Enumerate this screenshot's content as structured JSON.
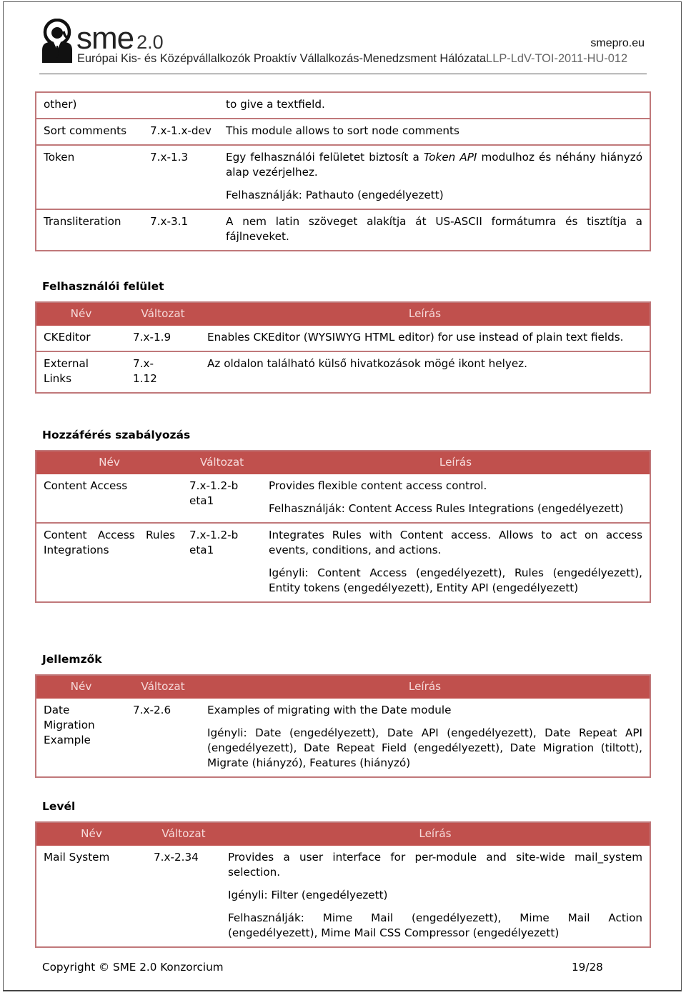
{
  "header": {
    "brand": "sme",
    "brand_version": "2.0",
    "site_url": "smepro.eu",
    "tagline": "Európai Kis- és Középvállalkozók Proaktív Vállalkozás-Menedzsment Hálózata",
    "project_code": "LLP-LdV-TOI-2011-HU-012",
    "logo_icon": "at-sign-person-icon"
  },
  "continued_table": {
    "rows": [
      {
        "name": "other)",
        "version": "",
        "description": [
          "to give a textfield."
        ]
      },
      {
        "name": "Sort comments",
        "version": "7.x-1.x-dev",
        "description": [
          "This module allows to sort node comments"
        ]
      },
      {
        "name": "Token",
        "version": "7.x-1.3",
        "description_pre": "Egy felhasználói felületet biztosít a ",
        "description_em": "Token API",
        "description_post": " modulhoz és néhány hiányzó alap vezérjelhez.",
        "description_extra": "Felhasználják: Pathauto (engedélyezett)"
      },
      {
        "name": "Transliteration",
        "version": "7.x-3.1",
        "description": [
          "A nem latin szöveget alakítja át US-ASCII formátumra és tisztítja a fájlneveket."
        ]
      }
    ]
  },
  "columns": {
    "name": "Név",
    "version": "Változat",
    "description": "Leírás"
  },
  "sections": [
    {
      "title": "Felhasználói felület",
      "rows": [
        {
          "name": "CKEditor",
          "version": "7.x-1.9",
          "description": [
            "Enables CKEditor (WYSIWYG HTML editor) for use instead of plain text fields."
          ]
        },
        {
          "name": "External Links",
          "version": "7.x-1.12",
          "description": [
            "Az oldalon található külső hivatkozások mögé ikont helyez."
          ]
        }
      ]
    },
    {
      "title": "Hozzáférés szabályozás",
      "rows": [
        {
          "name": "Content Access",
          "version": "7.x-1.2-beta1",
          "description": [
            "Provides flexible content access control.",
            "Felhasználják: Content Access Rules Integrations (engedélyezett)"
          ]
        },
        {
          "name": "Content Access Rules Integrations",
          "version": "7.x-1.2-beta1",
          "description": [
            "Integrates Rules with Content access. Allows to act on access events, conditions, and actions.",
            "Igényli: Content Access (engedélyezett), Rules (engedélyezett), Entity tokens (engedélyezett), Entity API (engedélyezett)"
          ]
        }
      ]
    },
    {
      "title": "Jellemzők",
      "rows": [
        {
          "name": "Date Migration Example",
          "version": "7.x-2.6",
          "description": [
            "Examples of migrating with the Date module",
            "Igényli: Date (engedélyezett), Date API (engedélyezett), Date Repeat API (engedélyezett), Date Repeat Field (engedélyezett), Date Migration (tiltott), Migrate (hiányzó), Features (hiányzó)"
          ]
        }
      ]
    },
    {
      "title": "Levél",
      "rows": [
        {
          "name": "Mail System",
          "version": "7.x-2.34",
          "description": [
            "Provides a user interface for per-module and site-wide mail_system selection.",
            "Igényli: Filter (engedélyezett)",
            "Felhasználják: Mime Mail (engedélyezett), Mime Mail Action (engedélyezett), Mime Mail CSS Compressor (engedélyezett)"
          ]
        }
      ]
    }
  ],
  "footer": {
    "copyright": "Copyright © SME 2.0 Konzorcium",
    "page": "19/28"
  },
  "colors": {
    "table_header_bg": "#c0504d",
    "table_header_text": "#f6dada",
    "table_border": "#c0787a"
  }
}
